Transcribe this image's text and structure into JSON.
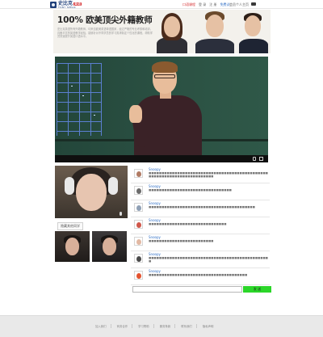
{
  "header": {
    "logo_cn": "史比克",
    "logo_badge": "英语",
    "logo_en": "TONY SPEAK",
    "links": [
      "口语课程",
      "登 录",
      "注 册",
      "免费试"
    ],
    "account": "会员个人主页"
  },
  "banner": {
    "title": "100% 欧美顶尖外籍教师",
    "description": "史比克英语所有外籍教师，均来自欧美英语母语国家，经过严格的专业考核和培训，具备丰富的英语教学经验，能够针对不同学员的学习需求制定个性化的课程，帮助学员快速提升英语口语水平。"
  },
  "video": {
    "volume_icon": "volume-icon",
    "fullscreen_icon": "fullscreen-icon"
  },
  "cams": {
    "hide_label": "隐藏其他同学"
  },
  "chat": {
    "messages": [
      {
        "name": "Snoopy",
        "text": "■■■■■■■■■■■■■■■■■■■■■■■■■■■■■■■■■■■■■■■■■■■■■■■■■■■■■■■■■■■■■■■■■■■■■■■"
      },
      {
        "name": "Snoopy",
        "text": "■■■■■■■■■■■■■■■■■■■■■■■■■■■■■■■■"
      },
      {
        "name": "Snoopy",
        "text": "■■■■■■■■■■■■■■■■■■■■■■■■■■■■■■■■■■■■■■■■■"
      },
      {
        "name": "Snoopy",
        "text": "■■■■■■■■■■■■■■■■■■■■■■■■■■■■■■"
      },
      {
        "name": "Snoopy",
        "text": "■■■■■■■■■■■■■■■■■■■■■■■■■"
      },
      {
        "name": "Snoopy",
        "text": "■■■■■■■■■■■■■■■■■■■■■■■■■■■■■■■■■■■■■■■■■■■■■■■"
      },
      {
        "name": "Snoopy",
        "text": "■■■■■■■■■■■■■■■■■■■■■■■■■■■■■■■■■■■■■■"
      }
    ],
    "input_value": "",
    "send_label": "发 送"
  },
  "footer": {
    "links": [
      "加入我们",
      "商务合作",
      "学习帮助",
      "服务条款",
      "联系我们",
      "隐私声明"
    ]
  },
  "colors": {
    "accent_blue": "#2f6fc6",
    "brand_red": "#d4282b",
    "send_green": "#2bd629"
  }
}
